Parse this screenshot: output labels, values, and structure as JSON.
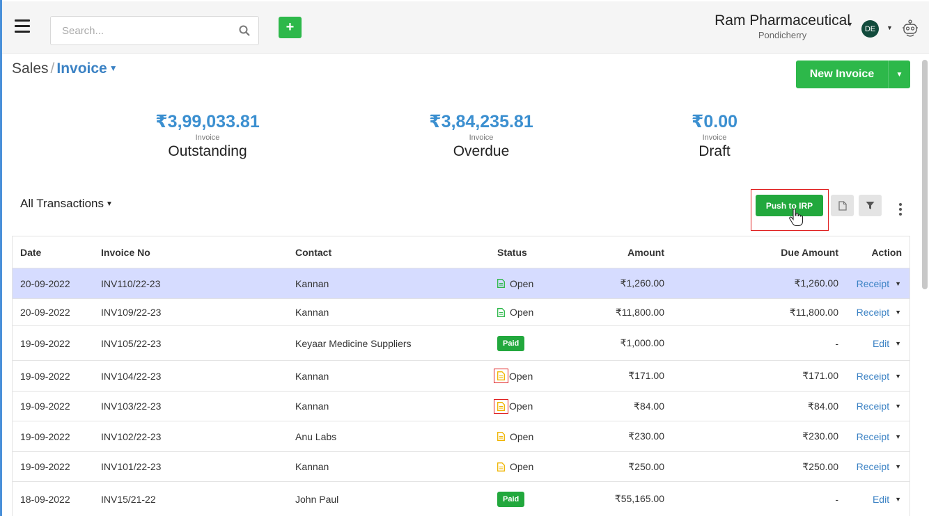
{
  "header": {
    "search_placeholder": "Search...",
    "add_label": "+",
    "company_name": "Ram Pharmaceutical",
    "company_city": "Pondicherry",
    "avatar_initials": "DE"
  },
  "breadcrumb": {
    "parent": "Sales",
    "separator": "/",
    "current": "Invoice"
  },
  "new_invoice_label": "New Invoice",
  "stats": [
    {
      "amount": "₹3,99,033.81",
      "sub": "Invoice",
      "label": "Outstanding"
    },
    {
      "amount": "₹3,84,235.81",
      "sub": "Invoice",
      "label": "Overdue"
    },
    {
      "amount": "₹0.00",
      "sub": "Invoice",
      "label": "Draft"
    }
  ],
  "filter_label": "All Transactions",
  "push_irp_label": "Push to IRP",
  "table": {
    "headers": {
      "date": "Date",
      "invoice_no": "Invoice No",
      "contact": "Contact",
      "status": "Status",
      "amount": "Amount",
      "due_amount": "Due Amount",
      "action": "Action"
    },
    "rows": [
      {
        "date": "20-09-2022",
        "invoice_no": "INV110/22-23",
        "contact": "Kannan",
        "status": "Open",
        "amount": "₹1,260.00",
        "due": "₹1,260.00",
        "action": "Receipt"
      },
      {
        "date": "20-09-2022",
        "invoice_no": "INV109/22-23",
        "contact": "Kannan",
        "status": "Open",
        "amount": "₹11,800.00",
        "due": "₹11,800.00",
        "action": "Receipt"
      },
      {
        "date": "19-09-2022",
        "invoice_no": "INV105/22-23",
        "contact": "Keyaar Medicine Suppliers",
        "status": "Paid",
        "amount": "₹1,000.00",
        "due": "-",
        "action": "Edit"
      },
      {
        "date": "19-09-2022",
        "invoice_no": "INV104/22-23",
        "contact": "Kannan",
        "status": "Open",
        "amount": "₹171.00",
        "due": "₹171.00",
        "action": "Receipt"
      },
      {
        "date": "19-09-2022",
        "invoice_no": "INV103/22-23",
        "contact": "Kannan",
        "status": "Open",
        "amount": "₹84.00",
        "due": "₹84.00",
        "action": "Receipt"
      },
      {
        "date": "19-09-2022",
        "invoice_no": "INV102/22-23",
        "contact": "Anu Labs",
        "status": "Open",
        "amount": "₹230.00",
        "due": "₹230.00",
        "action": "Receipt"
      },
      {
        "date": "19-09-2022",
        "invoice_no": "INV101/22-23",
        "contact": "Kannan",
        "status": "Open",
        "amount": "₹250.00",
        "due": "₹250.00",
        "action": "Receipt"
      },
      {
        "date": "18-09-2022",
        "invoice_no": "INV15/21-22",
        "contact": "John Paul",
        "status": "Paid",
        "amount": "₹55,165.00",
        "due": "-",
        "action": "Edit"
      }
    ]
  },
  "colors": {
    "accent_green": "#2db84a",
    "link_blue": "#3b82c4",
    "amount_blue": "#3b8fd0",
    "selected_row": "#d6dcff",
    "highlight_red": "#e02020",
    "doc_green": "#2db84a",
    "doc_yellow": "#f0b400"
  }
}
